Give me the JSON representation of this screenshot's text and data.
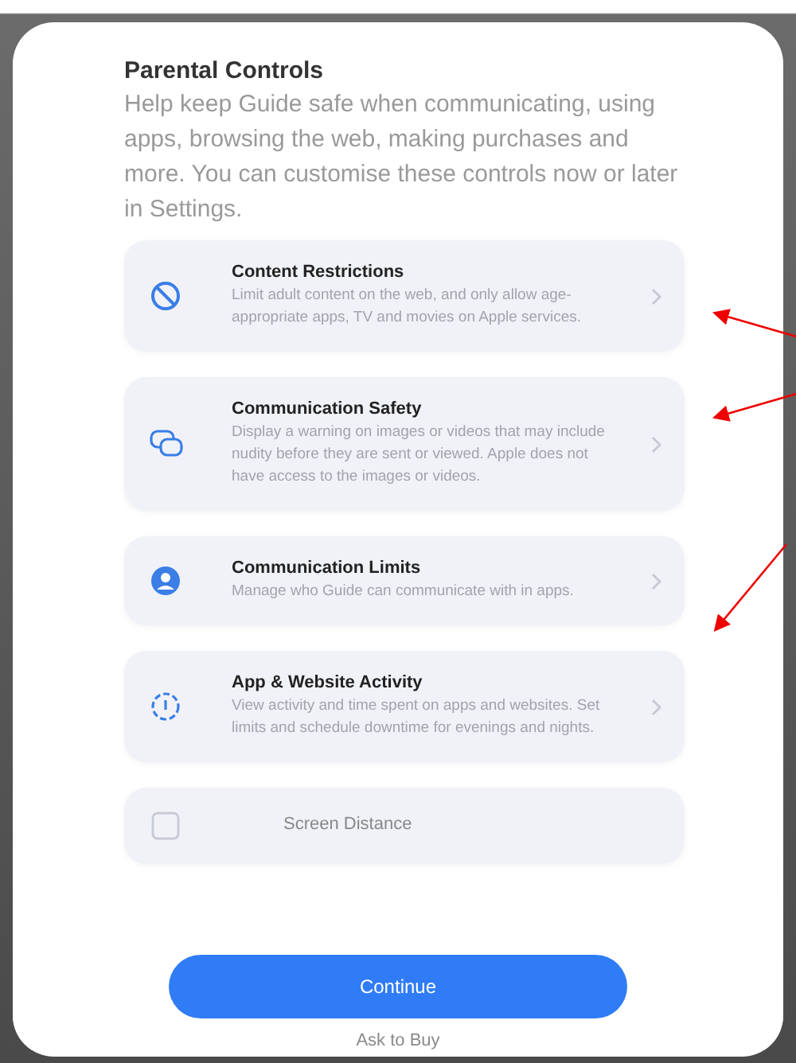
{
  "title": "Parental Controls",
  "intro": "Help keep Guide safe when communicating, using apps, browsing the web, making purchases and more. You can customise these controls now or later in Settings.",
  "options": [
    {
      "kind": "restrict",
      "title": "Content Restrictions",
      "description": "Limit adult content on the web, and only allow age-appropriate apps, TV and movies on Apple services."
    },
    {
      "kind": "chat",
      "title": "Communication Safety",
      "description": "Display a warning on images or videos that may include nudity before they are sent or viewed. Apple does not have access to the images or videos."
    },
    {
      "kind": "person",
      "title": "Communication Limits",
      "description": "Manage who Guide can communicate with in apps."
    },
    {
      "kind": "activity",
      "title": "App & Website Activity",
      "description": "View activity and time spent on apps and websites. Set limits and schedule downtime for evenings and nights."
    },
    {
      "kind": "distance",
      "title": "Screen Distance"
    }
  ],
  "continue_button": "Continue",
  "below_button": "Ask to Buy"
}
